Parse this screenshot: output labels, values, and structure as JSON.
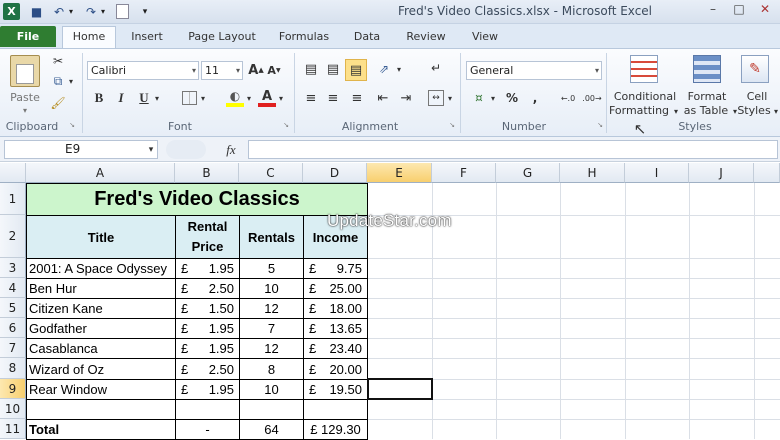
{
  "window": {
    "title": "Fred's Video Classics.xlsx - Microsoft Excel"
  },
  "tabs": [
    "File",
    "Home",
    "Insert",
    "Page Layout",
    "Formulas",
    "Data",
    "Review",
    "View"
  ],
  "ribbon": {
    "clipboard": {
      "label": "Clipboard",
      "paste": "Paste"
    },
    "font": {
      "label": "Font",
      "name": "Calibri",
      "size": "11"
    },
    "alignment": {
      "label": "Alignment"
    },
    "number": {
      "label": "Number",
      "format": "General"
    },
    "styles": {
      "label": "Styles",
      "conditional_1": "Conditional",
      "conditional_2": "Formatting",
      "format_table_1": "Format",
      "format_table_2": "as Table",
      "cell_styles_1": "Cell",
      "cell_styles_2": "Styles"
    }
  },
  "formula_bar": {
    "name_box": "E9",
    "fx": "fx",
    "value": ""
  },
  "columns": [
    "A",
    "B",
    "C",
    "D",
    "E",
    "F",
    "G",
    "H",
    "I",
    "J"
  ],
  "rows": [
    "1",
    "2",
    "3",
    "4",
    "5",
    "6",
    "7",
    "8",
    "9",
    "10",
    "11"
  ],
  "sheet": {
    "title": "Fred's Video Classics",
    "headers": {
      "title": "Title",
      "price_1": "Rental",
      "price_2": "Price",
      "rentals": "Rentals",
      "income": "Income"
    },
    "data": [
      {
        "title": "2001: A Space Odyssey",
        "cur": "£",
        "price": "1.95",
        "rentals": "5",
        "icur": "£",
        "income": "9.75"
      },
      {
        "title": "Ben Hur",
        "cur": "£",
        "price": "2.50",
        "rentals": "10",
        "icur": "£",
        "income": "25.00"
      },
      {
        "title": "Citizen Kane",
        "cur": "£",
        "price": "1.50",
        "rentals": "12",
        "icur": "£",
        "income": "18.00"
      },
      {
        "title": "Godfather",
        "cur": "£",
        "price": "1.95",
        "rentals": "7",
        "icur": "£",
        "income": "13.65"
      },
      {
        "title": "Casablanca",
        "cur": "£",
        "price": "1.95",
        "rentals": "12",
        "icur": "£",
        "income": "23.40"
      },
      {
        "title": "Wizard of Oz",
        "cur": "£",
        "price": "2.50",
        "rentals": "8",
        "icur": "£",
        "income": "20.00"
      },
      {
        "title": "Rear Window",
        "cur": "£",
        "price": "1.95",
        "rentals": "10",
        "icur": "£",
        "income": "19.50"
      }
    ],
    "total": {
      "label": "Total",
      "price": "-",
      "rentals": "64",
      "income": "£ 129.30"
    }
  },
  "watermark": "UpdateStar.com",
  "colors": {
    "title_fill": "#ccf5cc",
    "header_fill": "#daeef3",
    "file_tab": "#2f7d31"
  }
}
